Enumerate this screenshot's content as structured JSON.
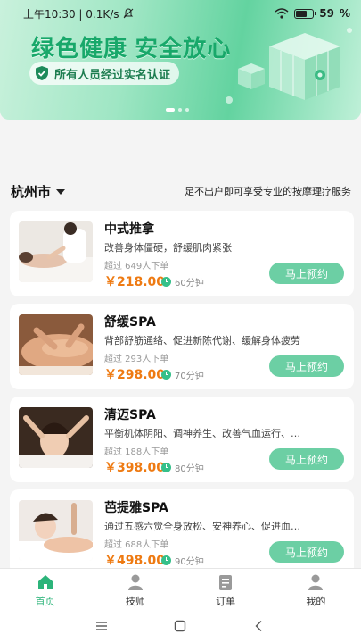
{
  "status_bar": {
    "time_speed": "上午10:30 | 0.1K/s",
    "battery": "59"
  },
  "banner": {
    "title": "绿色健康 安全放心",
    "badge_text": "所有人员经过实名认证",
    "slide_index": 1,
    "slide_count": 3
  },
  "location": {
    "city": "杭州市",
    "tagline": "足不出户即可享受专业的按摩理疗服务"
  },
  "services": [
    {
      "name": "中式推拿",
      "desc": "改善身体僵硬，舒缓肌肉紧张",
      "sold": "超过 649人下单",
      "price": "￥218.00",
      "duration": "60分钟",
      "button": "马上预约"
    },
    {
      "name": "舒缓SPA",
      "desc": "背部舒筋通络、促进新陈代谢、缓解身体疲劳",
      "sold": "超过 293人下单",
      "price": "￥298.00",
      "duration": "70分钟",
      "button": "马上预约"
    },
    {
      "name": "清迈SPA",
      "desc": "平衡机体阴阳、调神养生、改善气血运行、…",
      "sold": "超过 188人下单",
      "price": "￥398.00",
      "duration": "80分钟",
      "button": "马上预约"
    },
    {
      "name": "芭提雅SPA",
      "desc": "通过五感六觉全身放松、安神养心、促进血…",
      "sold": "超过 688人下单",
      "price": "￥498.00",
      "duration": "90分钟",
      "button": "马上预约"
    }
  ],
  "tabs": [
    {
      "label": "首页",
      "icon": "home-icon",
      "active": true
    },
    {
      "label": "技师",
      "icon": "person-icon",
      "active": false
    },
    {
      "label": "订单",
      "icon": "order-icon",
      "active": false
    },
    {
      "label": "我的",
      "icon": "profile-icon",
      "active": false
    }
  ],
  "colors": {
    "accent": "#2cb47a",
    "button": "#6ccfa4",
    "price": "#ee7a12"
  }
}
